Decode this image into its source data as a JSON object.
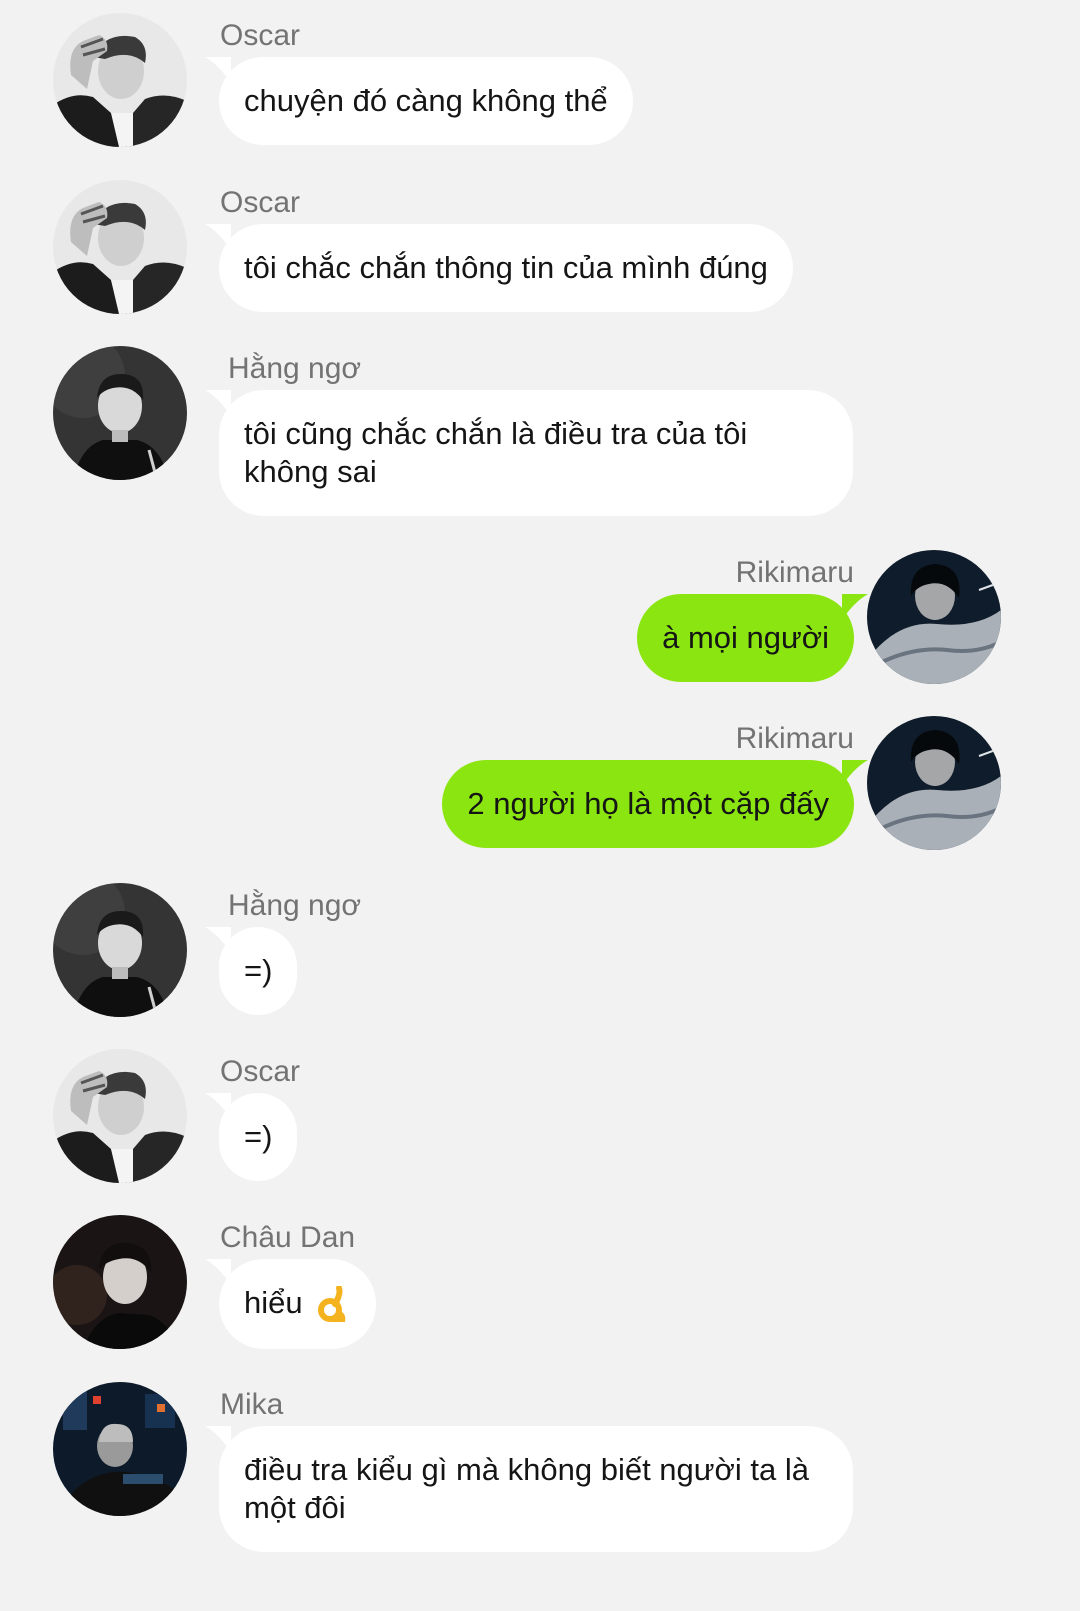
{
  "colors": {
    "background": "#f2f2f2",
    "incoming_bubble": "#ffffff",
    "outgoing_bubble": "#8be510",
    "sender_name": "#737373",
    "text": "#151515"
  },
  "messages": [
    {
      "sender": "Oscar",
      "text": "chuyện đó càng không thể",
      "direction": "incoming",
      "avatar": "oscar-avatar"
    },
    {
      "sender": "Oscar",
      "text": "tôi chắc chắn thông tin của mình đúng",
      "direction": "incoming",
      "avatar": "oscar-avatar"
    },
    {
      "sender": "Hằng ngơ",
      "text": "tôi cũng chắc chắn là điều tra của tôi không sai",
      "direction": "incoming",
      "avatar": "hang-ngo-avatar"
    },
    {
      "sender": "Rikimaru",
      "text": "à mọi người",
      "direction": "outgoing",
      "avatar": "rikimaru-avatar"
    },
    {
      "sender": "Rikimaru",
      "text": "2 người họ là một cặp đấy",
      "direction": "outgoing",
      "avatar": "rikimaru-avatar"
    },
    {
      "sender": "Hằng ngơ",
      "text": "=)",
      "direction": "incoming",
      "avatar": "hang-ngo-avatar"
    },
    {
      "sender": "Oscar",
      "text": "=)",
      "direction": "incoming",
      "avatar": "oscar-avatar"
    },
    {
      "sender": "Châu Dan",
      "text": "hiểu",
      "emoji": "ok-hand-emoji",
      "direction": "incoming",
      "avatar": "chau-dan-avatar"
    },
    {
      "sender": "Mika",
      "text": "điều tra kiểu gì mà không biết người ta là một đôi",
      "direction": "incoming",
      "avatar": "mika-avatar"
    }
  ]
}
